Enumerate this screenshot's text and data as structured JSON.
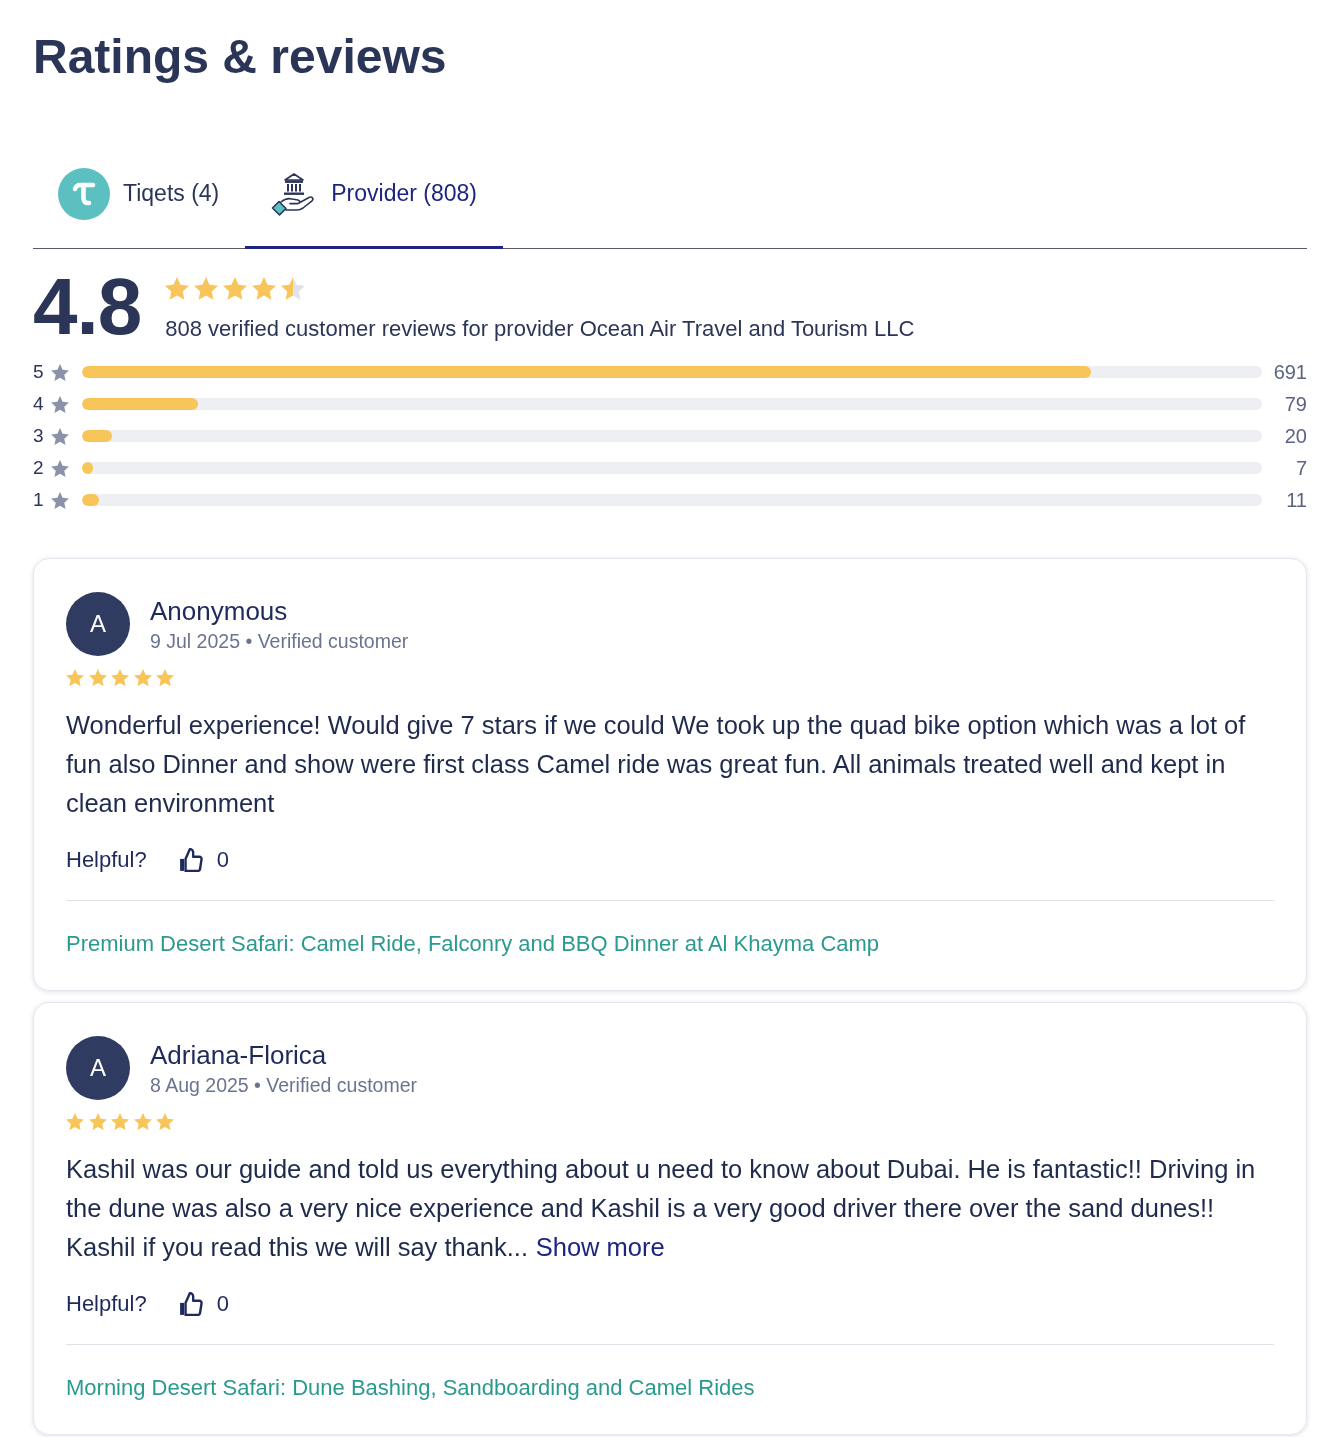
{
  "title": "Ratings & reviews",
  "tabs": [
    {
      "kind": "tiqets",
      "label": "Tiqets (4)",
      "selected": false
    },
    {
      "kind": "provider",
      "label": "Provider (808)",
      "selected": true
    }
  ],
  "summary": {
    "score": "4.8",
    "stars": 4.5,
    "caption": "808 verified customer reviews for provider Ocean Air Travel and Tourism LLC"
  },
  "distribution": [
    {
      "rating": "5",
      "level": 0.855,
      "count": "691"
    },
    {
      "rating": "4",
      "level": 0.098,
      "count": "79"
    },
    {
      "rating": "3",
      "level": 0.025,
      "count": "20"
    },
    {
      "rating": "2",
      "level": 0.009,
      "count": "7"
    },
    {
      "rating": "1",
      "level": 0.014,
      "count": "11"
    }
  ],
  "reviews": [
    {
      "initial": "A",
      "author": "Anonymous",
      "meta": "9 Jul 2025 • Verified customer",
      "stars": 5,
      "text": "Wonderful experience! Would give 7 stars if we could We took up the quad bike option which was a lot of fun also Dinner and show were first class Camel ride was great fun. All animals treated well and kept in clean environment",
      "helpful_label": "Helpful?",
      "helpful_count": "0",
      "product": "Premium Desert Safari: Camel Ride, Falconry and BBQ Dinner at Al Khayma Camp"
    },
    {
      "initial": "A",
      "author": "Adriana-Florica",
      "meta": "8 Aug 2025 • Verified customer",
      "stars": 5,
      "text": "Kashil was our guide and told us everything about u need to know about Dubai. He is fantastic!! Driving in the dune was also a very nice experience and Kashil is a very good driver there over the sand dunes!! Kashil if you read this we will say thank...",
      "show_more": "Show more",
      "helpful_label": "Helpful?",
      "helpful_count": "0",
      "product": "Morning Desert Safari: Dune Bashing, Sandboarding and Camel Rides"
    }
  ]
}
